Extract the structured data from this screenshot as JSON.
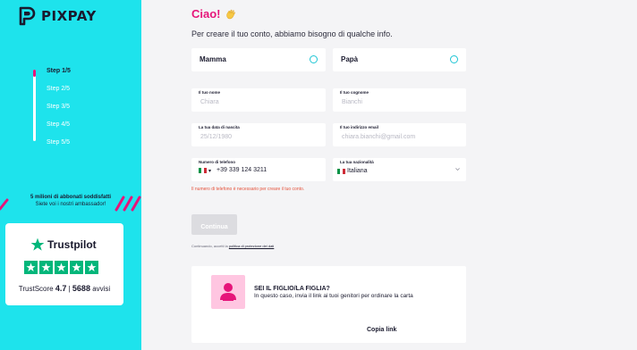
{
  "brand": {
    "name": "PIXPAY"
  },
  "sidebar": {
    "steps": [
      {
        "label": "Step 1/5"
      },
      {
        "label": "Step 2/5"
      },
      {
        "label": "Step 3/5"
      },
      {
        "label": "Step 4/5"
      },
      {
        "label": "Step 5/5"
      }
    ],
    "active_step": 1,
    "subscribers_title": "5 milioni di abbonati soddisfatti",
    "subscribers_sub": "Siete voi i nostri ambassador!",
    "trust": {
      "brand": "Trustpilot",
      "stars": 5,
      "score_prefix": "TrustScore",
      "score": "4.7",
      "separator": "|",
      "reviews": "5688",
      "reviews_suffix": "avvisi"
    }
  },
  "main": {
    "greeting": "Ciao!",
    "intro": "Per creare il tuo conto, abbiamo bisogno di qualche info.",
    "role_options": [
      {
        "label": "Mamma"
      },
      {
        "label": "Papà"
      }
    ],
    "fields": {
      "first_name": {
        "label": "Il tuo nome",
        "placeholder": "Chiara"
      },
      "last_name": {
        "label": "Il tuo cognome",
        "placeholder": "Bianchi"
      },
      "birth_date": {
        "label": "La tua data di nascita",
        "placeholder": "25/12/1980"
      },
      "email": {
        "label": "Il tuo indirizzo email",
        "placeholder": "chiara.bianchi@gmail.com"
      },
      "phone": {
        "label": "Numero di telefono",
        "value": "+39 339 124 3211"
      },
      "nationality": {
        "label": "La tua nazionalità",
        "value": "Italiana"
      }
    },
    "error": "Il numero di telefono è necessario per creare il tuo conto.",
    "continue_label": "Continua",
    "privacy_prefix": "Continuando, accetti la",
    "privacy_link": "politica di protezione dei dati",
    "child_card": {
      "title": "SEI IL FIGLIO/LA FIGLIA?",
      "description": "In questo caso, invia il link ai tuoi genitori per ordinare la carta",
      "copy_label": "Copia link"
    }
  },
  "colors": {
    "sidebar_bg": "#1ee3ec",
    "accent_pink": "#e6157a",
    "trustpilot_green": "#00b67a",
    "radio_border": "#1ec5d4",
    "error": "#e5533c"
  }
}
